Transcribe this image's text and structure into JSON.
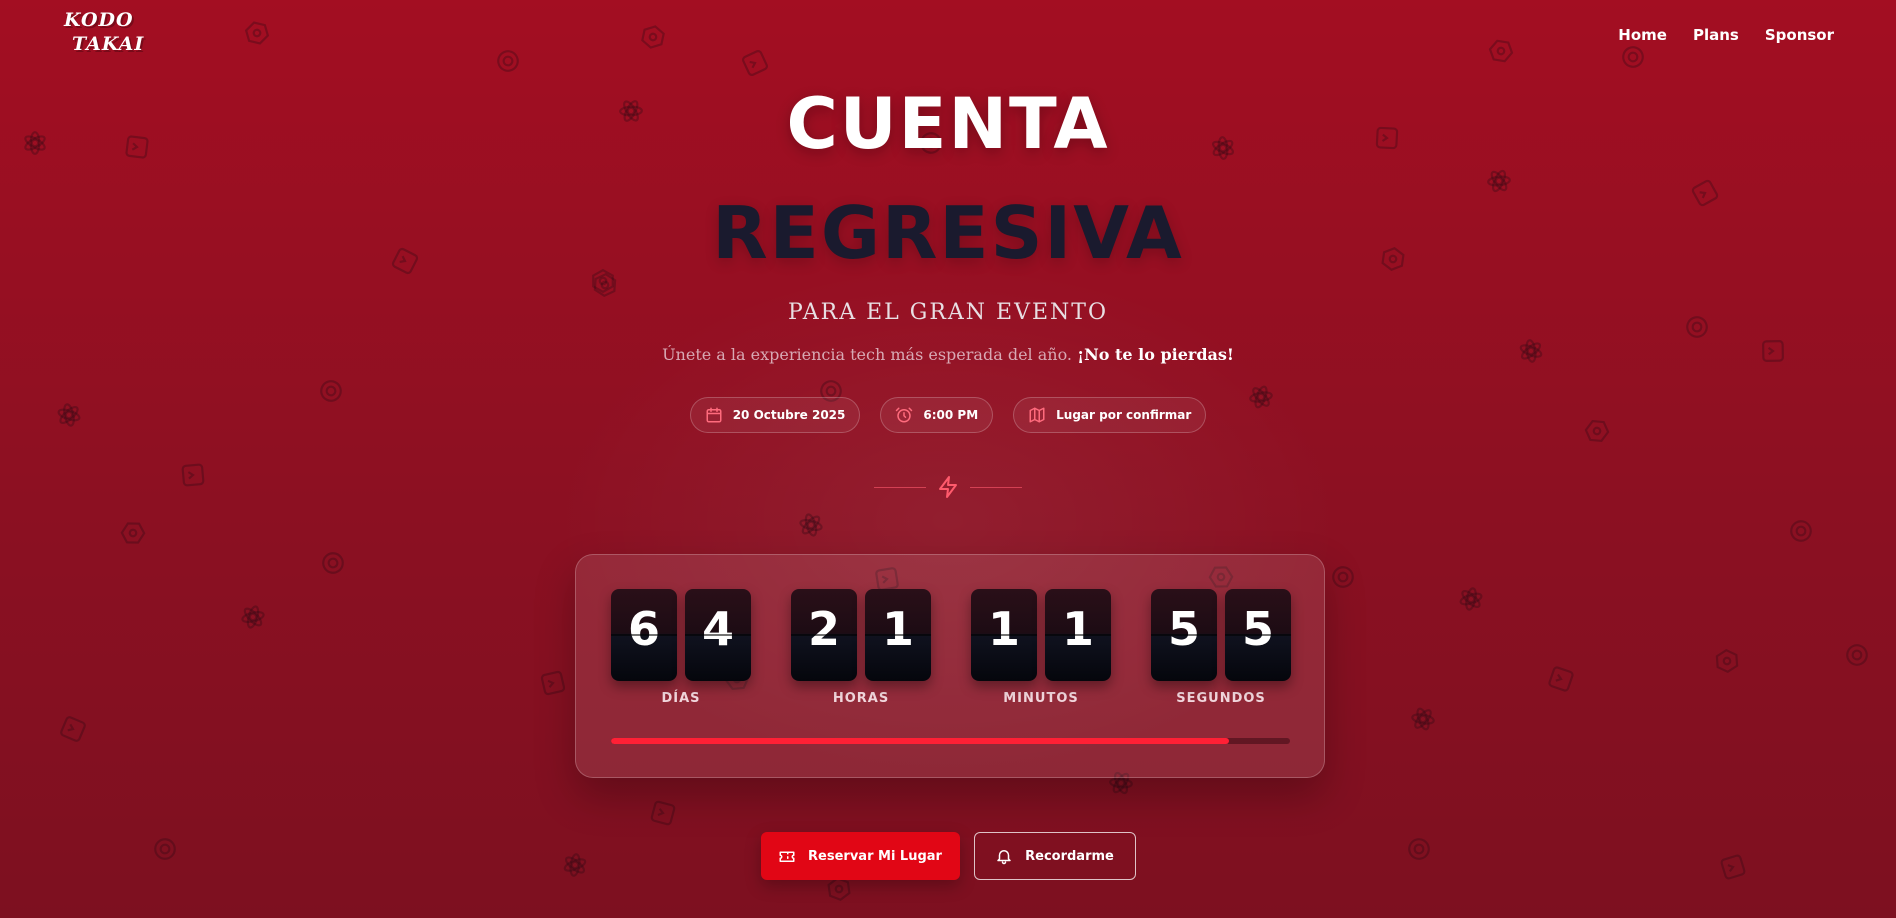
{
  "logo": {
    "line1": "KODO",
    "line2": "TAKAI"
  },
  "nav": {
    "items": [
      "Home",
      "Plans",
      "Sponsor"
    ]
  },
  "hero": {
    "title_line1": "CUENTA",
    "title_line2": "REGRESIVA",
    "subtitle": "PARA EL GRAN EVENTO",
    "tagline": "Únete a la experiencia tech más esperada del año.",
    "tagline_highlight": "¡No te lo pierdas!"
  },
  "details": {
    "date": {
      "icon": "calendar-icon",
      "text": "20 Octubre 2025"
    },
    "time": {
      "icon": "clock-icon",
      "text": "6:00 PM"
    },
    "location": {
      "icon": "map-icon",
      "text": "Lugar por confirmar"
    }
  },
  "countdown": {
    "units": [
      {
        "label": "DÍAS",
        "digits": [
          "6",
          "4"
        ]
      },
      {
        "label": "HORAS",
        "digits": [
          "2",
          "1"
        ]
      },
      {
        "label": "MINUTOS",
        "digits": [
          "1",
          "1"
        ]
      },
      {
        "label": "SEGUNDOS",
        "digits": [
          "5",
          "5"
        ]
      }
    ],
    "progress_percent": 91
  },
  "buttons": {
    "reserve": {
      "icon": "ticket-icon",
      "label": "Reservar Mi Lugar"
    },
    "remind": {
      "icon": "bell-icon",
      "label": "Recordarme"
    }
  },
  "colors": {
    "background_top": "#a30e22",
    "background_bottom": "#7d1020",
    "title_dark": "#1a1a2e",
    "accent": "#e10615",
    "progress": "#ff2035",
    "icon_accent": "#ff6b7d"
  }
}
